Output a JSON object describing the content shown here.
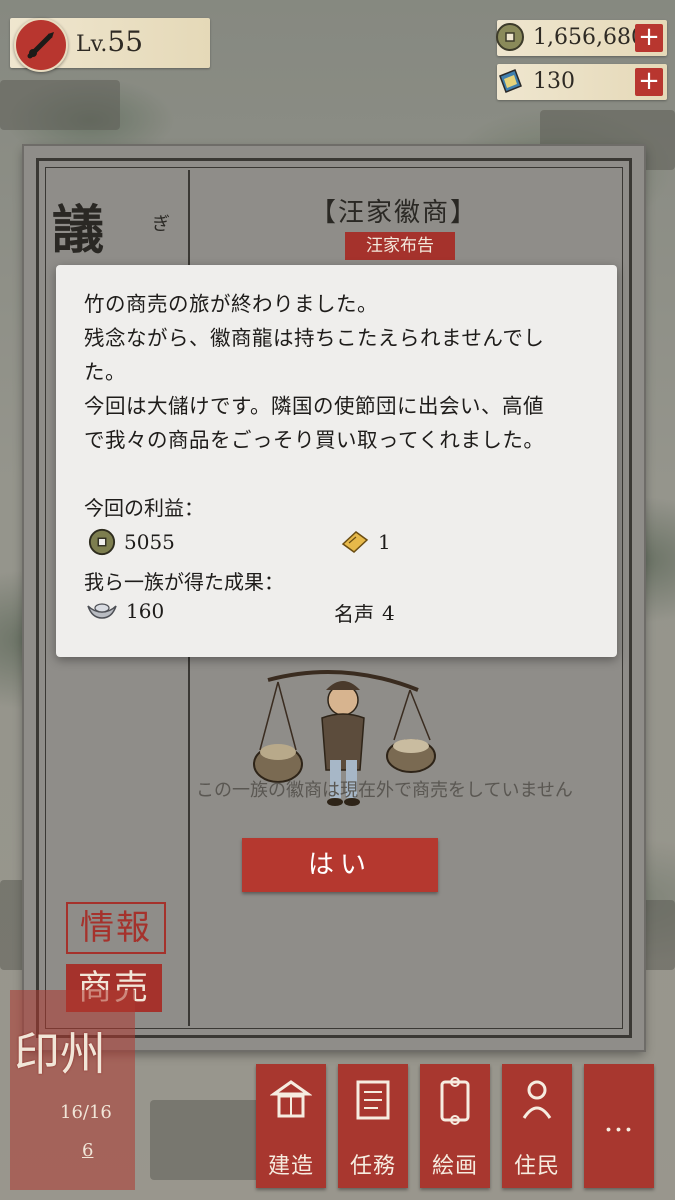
{
  "hud": {
    "level_prefix": "Lv.",
    "level_value": "55",
    "coins": "1,656,680",
    "gems": "130",
    "plus": "+"
  },
  "panel": {
    "kanji": "議",
    "ruby": "ぎ",
    "family_title": "【汪家徽商】",
    "family_badge": "汪家布告",
    "no_trade_text": "この一族の徽商は現在外で商売をしていません",
    "yes_button": "はい",
    "side_tabs": {
      "info": "情報",
      "trade": "商売"
    }
  },
  "dialog": {
    "line1": "竹の商売の旅が終わりました。",
    "line2": "残念ながら、徽商龍は持ちこたえられませんでし",
    "line3": "た。",
    "line4": "今回は大儲けです。隣国の使節団に出会い、高値",
    "line5": "で我々の商品をごっそり買い取ってくれました。",
    "profit_label": "今回の利益：",
    "coins_gained": "5055",
    "tickets_gained": "1",
    "clan_label": "我ら一族が得た成果：",
    "silver_gained": "160",
    "fame_label": "名声",
    "fame_value": "4"
  },
  "city": {
    "name": "印州",
    "population": "16/16",
    "count": "6"
  },
  "bottom_menu": [
    {
      "label": "建造",
      "icon": "build-icon"
    },
    {
      "label": "任務",
      "icon": "task-icon"
    },
    {
      "label": "絵画",
      "icon": "painting-icon"
    },
    {
      "label": "住民",
      "icon": "resident-icon"
    },
    {
      "label": "…",
      "icon": "more-icon"
    }
  ],
  "colors": {
    "accent_red": "#a5322c",
    "panel_gray": "#8f8d89",
    "dialog_bg": "#efeeec",
    "parchment": "#efe6cf"
  }
}
